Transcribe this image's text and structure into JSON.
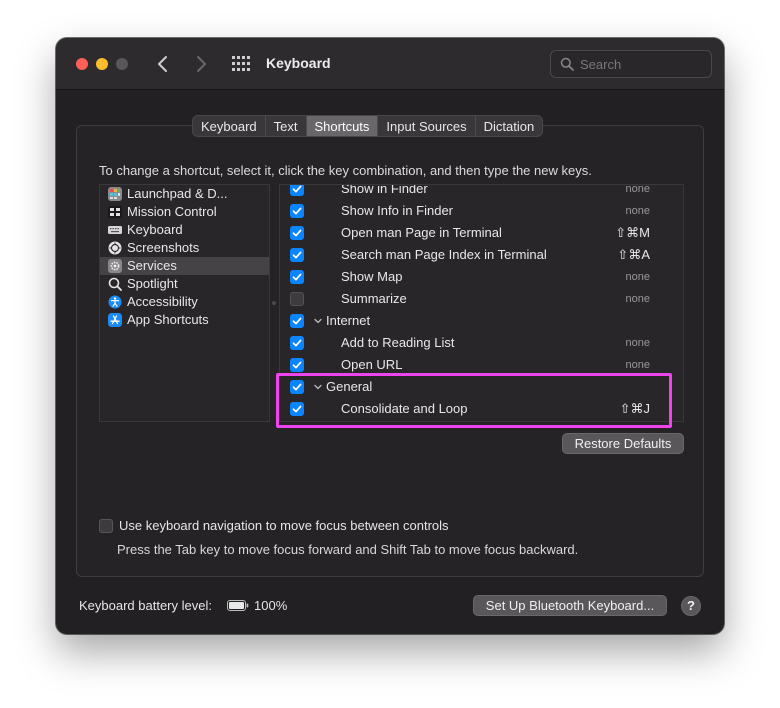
{
  "window": {
    "title": "Keyboard",
    "search_placeholder": "Search"
  },
  "tabs": [
    {
      "label": "Keyboard"
    },
    {
      "label": "Text"
    },
    {
      "label": "Shortcuts",
      "active": true
    },
    {
      "label": "Input Sources"
    },
    {
      "label": "Dictation"
    }
  ],
  "instructions": "To change a shortcut, select it, click the key combination, and then type the new keys.",
  "categories": [
    {
      "label": "Launchpad & D...",
      "icon": "launchpad-icon"
    },
    {
      "label": "Mission Control",
      "icon": "mission-control-icon"
    },
    {
      "label": "Keyboard",
      "icon": "keyboard-icon"
    },
    {
      "label": "Screenshots",
      "icon": "screenshot-icon"
    },
    {
      "label": "Services",
      "icon": "gear-icon",
      "selected": true
    },
    {
      "label": "Spotlight",
      "icon": "spotlight-icon"
    },
    {
      "label": "Accessibility",
      "icon": "accessibility-icon"
    },
    {
      "label": "App Shortcuts",
      "icon": "app-store-icon"
    }
  ],
  "services": [
    {
      "name": "Show in Finder",
      "shortcut": "none",
      "checked": true
    },
    {
      "name": "Show Info in Finder",
      "shortcut": "none",
      "checked": true
    },
    {
      "name": "Open man Page in Terminal",
      "shortcut": "⇧⌘M",
      "checked": true
    },
    {
      "name": "Search man Page Index in Terminal",
      "shortcut": "⇧⌘A",
      "checked": true
    },
    {
      "name": "Show Map",
      "shortcut": "none",
      "checked": true
    },
    {
      "name": "Summarize",
      "shortcut": "none",
      "checked": false
    },
    {
      "name": "Internet",
      "shortcut": "",
      "checked": true,
      "group": true
    },
    {
      "name": "Add to Reading List",
      "shortcut": "none",
      "checked": true
    },
    {
      "name": "Open URL",
      "shortcut": "none",
      "checked": true
    },
    {
      "name": "General",
      "shortcut": "",
      "checked": true,
      "group": true
    },
    {
      "name": "Consolidate and Loop",
      "shortcut": "⇧⌘J",
      "checked": true
    }
  ],
  "restore_defaults_label": "Restore Defaults",
  "keyboard_navigation": {
    "checked": false,
    "label": "Use keyboard navigation to move focus between controls",
    "hint": "Press the Tab key to move focus forward and Shift Tab to move focus backward."
  },
  "battery": {
    "label": "Keyboard battery level:",
    "percent": "100%",
    "level": 1.0
  },
  "bluetooth_button_label": "Set Up Bluetooth Keyboard...",
  "help_label": "?",
  "colors": {
    "accent": "#0a84ff",
    "highlight": "#ee44ee",
    "window_bg": "#232024"
  }
}
